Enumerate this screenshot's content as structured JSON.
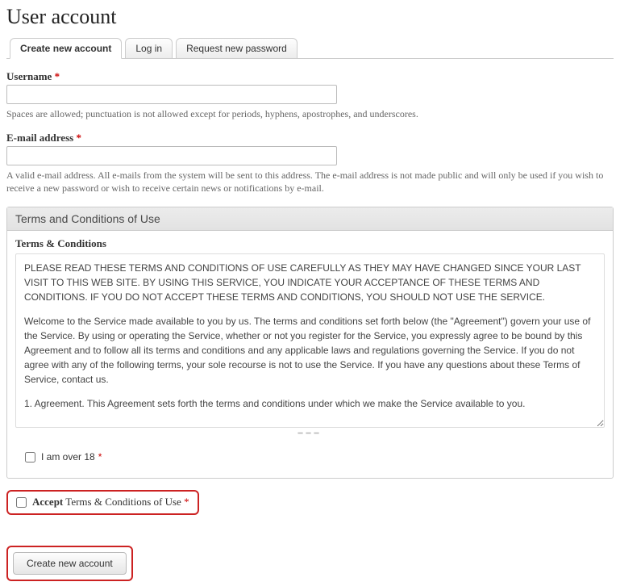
{
  "page": {
    "title": "User account"
  },
  "tabs": {
    "create": "Create new account",
    "login": "Log in",
    "password": "Request new password"
  },
  "username": {
    "label": "Username",
    "help": "Spaces are allowed; punctuation is not allowed except for periods, hyphens, apostrophes, and underscores."
  },
  "email": {
    "label": "E-mail address",
    "help": "A valid e-mail address. All e-mails from the system will be sent to this address. The e-mail address is not made public and will only be used if you wish to receive a new password or wish to receive certain news or notifications by e-mail."
  },
  "terms": {
    "fieldset_title": "Terms and Conditions of Use",
    "label": "Terms & Conditions",
    "para1": "PLEASE READ THESE TERMS AND CONDITIONS OF USE CAREFULLY AS THEY MAY HAVE CHANGED SINCE YOUR LAST VISIT TO THIS WEB SITE. BY USING THIS SERVICE, YOU INDICATE YOUR ACCEPTANCE OF THESE TERMS AND CONDITIONS. IF YOU DO NOT ACCEPT THESE TERMS AND CONDITIONS, YOU SHOULD NOT USE THE SERVICE.",
    "para2": "Welcome to the Service made available to you by us. The terms and conditions set forth below (the \"Agreement\") govern your use of the Service. By using or operating the Service, whether or not you register for the Service, you expressly agree to be bound by this Agreement and to follow all its terms and conditions and any applicable laws and regulations governing the Service. If you do not agree with any of the following terms, your sole recourse is not to use the Service. If you have any questions about these Terms of Service, contact us.",
    "para3": "1. Agreement. This Agreement sets forth the terms and conditions under which we make the Service available to you."
  },
  "over18": {
    "label": "I am over 18"
  },
  "accept": {
    "bold": "Accept",
    "rest": " Terms & Conditions of Use "
  },
  "submit": {
    "label": "Create new account"
  },
  "required_marker": "*"
}
